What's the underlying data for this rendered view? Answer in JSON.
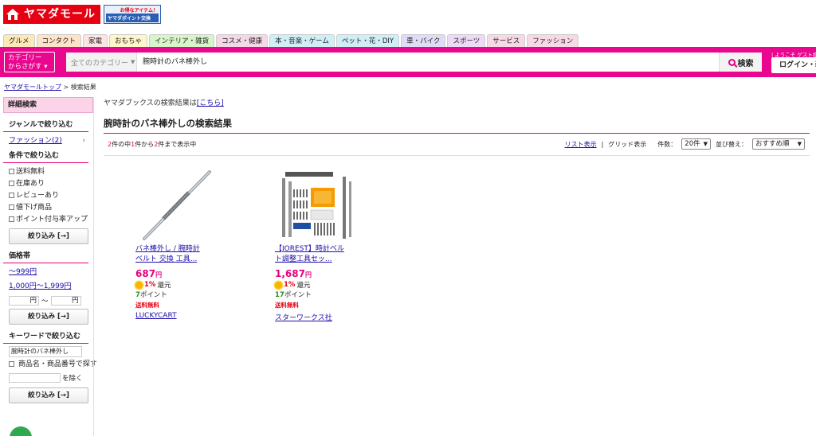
{
  "header": {
    "logo_text": "ヤマダモール",
    "promo_line1": "お得なアイテム！",
    "promo_line2": "ヤマダポイント交換"
  },
  "tabs": [
    {
      "label": "グルメ",
      "color": "#fde9b8"
    },
    {
      "label": "コンタクト",
      "color": "#fde3c8"
    },
    {
      "label": "家電",
      "color": "#fde3e3"
    },
    {
      "label": "おもちゃ",
      "color": "#fef6c8"
    },
    {
      "label": "インテリア・雑貨",
      "color": "#d8f5c9"
    },
    {
      "label": "コスメ・健康",
      "color": "#f5d8e8"
    },
    {
      "label": "本・音楽・ゲーム",
      "color": "#cfeef6"
    },
    {
      "label": "ペット・花・DIY",
      "color": "#cfeef6"
    },
    {
      "label": "車・バイク",
      "color": "#e0dcf7"
    },
    {
      "label": "スポーツ",
      "color": "#eedaf6"
    },
    {
      "label": "サービス",
      "color": "#f7d8e6"
    },
    {
      "label": "ファッション",
      "color": "#f7d8e6"
    }
  ],
  "search": {
    "category_button": "カテゴリー\nからさがす",
    "category_select": "全てのカテゴリー",
    "query": "腕時計のバネ棒外し",
    "button_label": "検索",
    "welcome": "| ようこそ ゲスト様",
    "login_label": "ログイン・新"
  },
  "breadcrumb": {
    "home": "ヤマダモールトップ",
    "separator": ">",
    "current": "検索結果"
  },
  "sidebar": {
    "detail_search": "詳細検索",
    "genre_section": "ジャンルで絞り込む",
    "genre_item": "ファッション(2)",
    "condition_section": "条件で絞り込む",
    "conditions": [
      "送料無料",
      "在庫あり",
      "レビューあり",
      "値下げ商品",
      "ポイント付与率アップ"
    ],
    "refine_button": "絞り込み [→]",
    "price_section": "価格帯",
    "price_ranges": [
      "～999円",
      "1,000円～1,999円"
    ],
    "price_unit": "円",
    "price_tilde": "～",
    "keyword_section": "キーワードで絞り込む",
    "keyword_value": "腕時計のバネ棒外し",
    "keyword_option": "商品名・商品番号で探す",
    "exclude_label": "を除く"
  },
  "main": {
    "books_note_prefix": "ヤマダブックスの検索結果は",
    "books_note_link": "[こちら]",
    "result_title": "腕時計のバネ棒外しの検索結果",
    "count_total": "2",
    "count_text1": "件の中",
    "count_from": "1",
    "count_text2": "件から",
    "count_to": "2",
    "count_text3": "件まで表示中",
    "list_view": "リスト表示",
    "view_sep": "|",
    "grid_view": "グリッド表示",
    "per_page_label": "件数：",
    "per_page_value": "20件",
    "sort_label": "並び替え：",
    "sort_value": "おすすめ順"
  },
  "products": [
    {
      "title": "バネ棒外し / 腕時計 ベルト 交換 工具...",
      "price": "687",
      "yen": "円",
      "cashback_pct": "1%",
      "cashback_label": "還元",
      "points": "7",
      "points_label": "ポイント",
      "shipping": "送料無料",
      "shop": "LUCKYCART"
    },
    {
      "title": "【JOREST】時計ベルト調整工具セッ...",
      "price": "1,687",
      "yen": "円",
      "cashback_pct": "1%",
      "cashback_label": "還元",
      "points": "17",
      "points_label": "ポイント",
      "shipping": "送料無料",
      "shop": "スターワークス社"
    }
  ],
  "colors": {
    "brand_red": "#e60012",
    "brand_pink": "#ea068e",
    "link": "#1a0dab"
  }
}
